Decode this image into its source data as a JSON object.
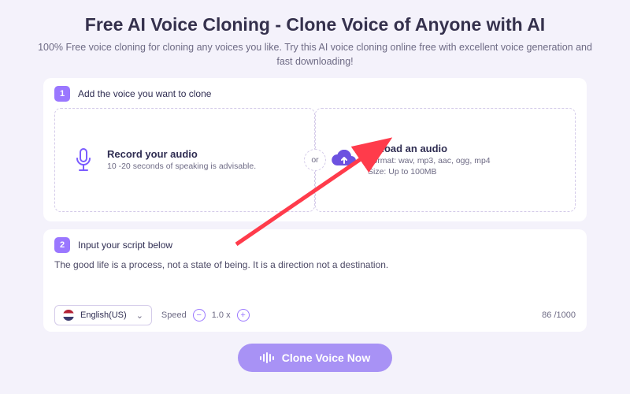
{
  "header": {
    "title": "Free AI Voice Cloning - Clone Voice of Anyone with AI",
    "subtitle": "100% Free voice cloning for cloning any voices you like. Try this AI voice cloning online free with excellent voice generation and fast downloading!"
  },
  "step1": {
    "badge": "1",
    "label": "Add the voice you want to clone",
    "record": {
      "title": "Record your audio",
      "desc": "10 -20 seconds of speaking is advisable."
    },
    "or": "or",
    "upload": {
      "title": "Upload an audio",
      "desc1": "Format: wav, mp3, aac, ogg, mp4",
      "desc2": "Size: Up to 100MB"
    }
  },
  "step2": {
    "badge": "2",
    "label": "Input your script below",
    "text": "The good life is a process, not a state of being. It is a direction not a destination."
  },
  "controls": {
    "language": "English(US)",
    "speed_label": "Speed",
    "speed_value": "1.0 x",
    "counter": "86 /1000"
  },
  "cta": {
    "label": "Clone Voice Now"
  }
}
